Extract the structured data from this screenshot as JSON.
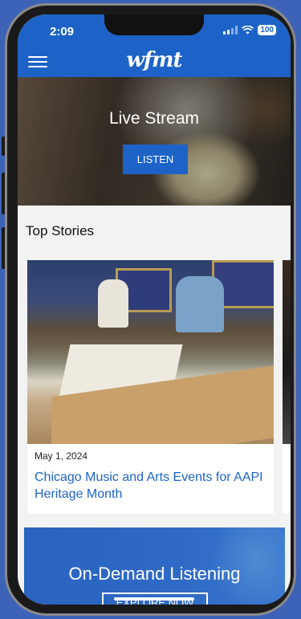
{
  "status": {
    "time": "2:09",
    "battery": "100"
  },
  "header": {
    "logo": "wfmt"
  },
  "hero": {
    "title": "Live Stream",
    "button": "LISTEN"
  },
  "top_stories": {
    "title": "Top Stories",
    "stories": [
      {
        "date": "May 1, 2024",
        "headline": "Chicago Music and Arts Events for AAPI Heritage Month"
      }
    ]
  },
  "on_demand": {
    "title": "On-Demand Listening",
    "button": "EXPLORE NOW"
  },
  "colors": {
    "brand_blue": "#1d63c7",
    "background": "#3d63b8"
  }
}
